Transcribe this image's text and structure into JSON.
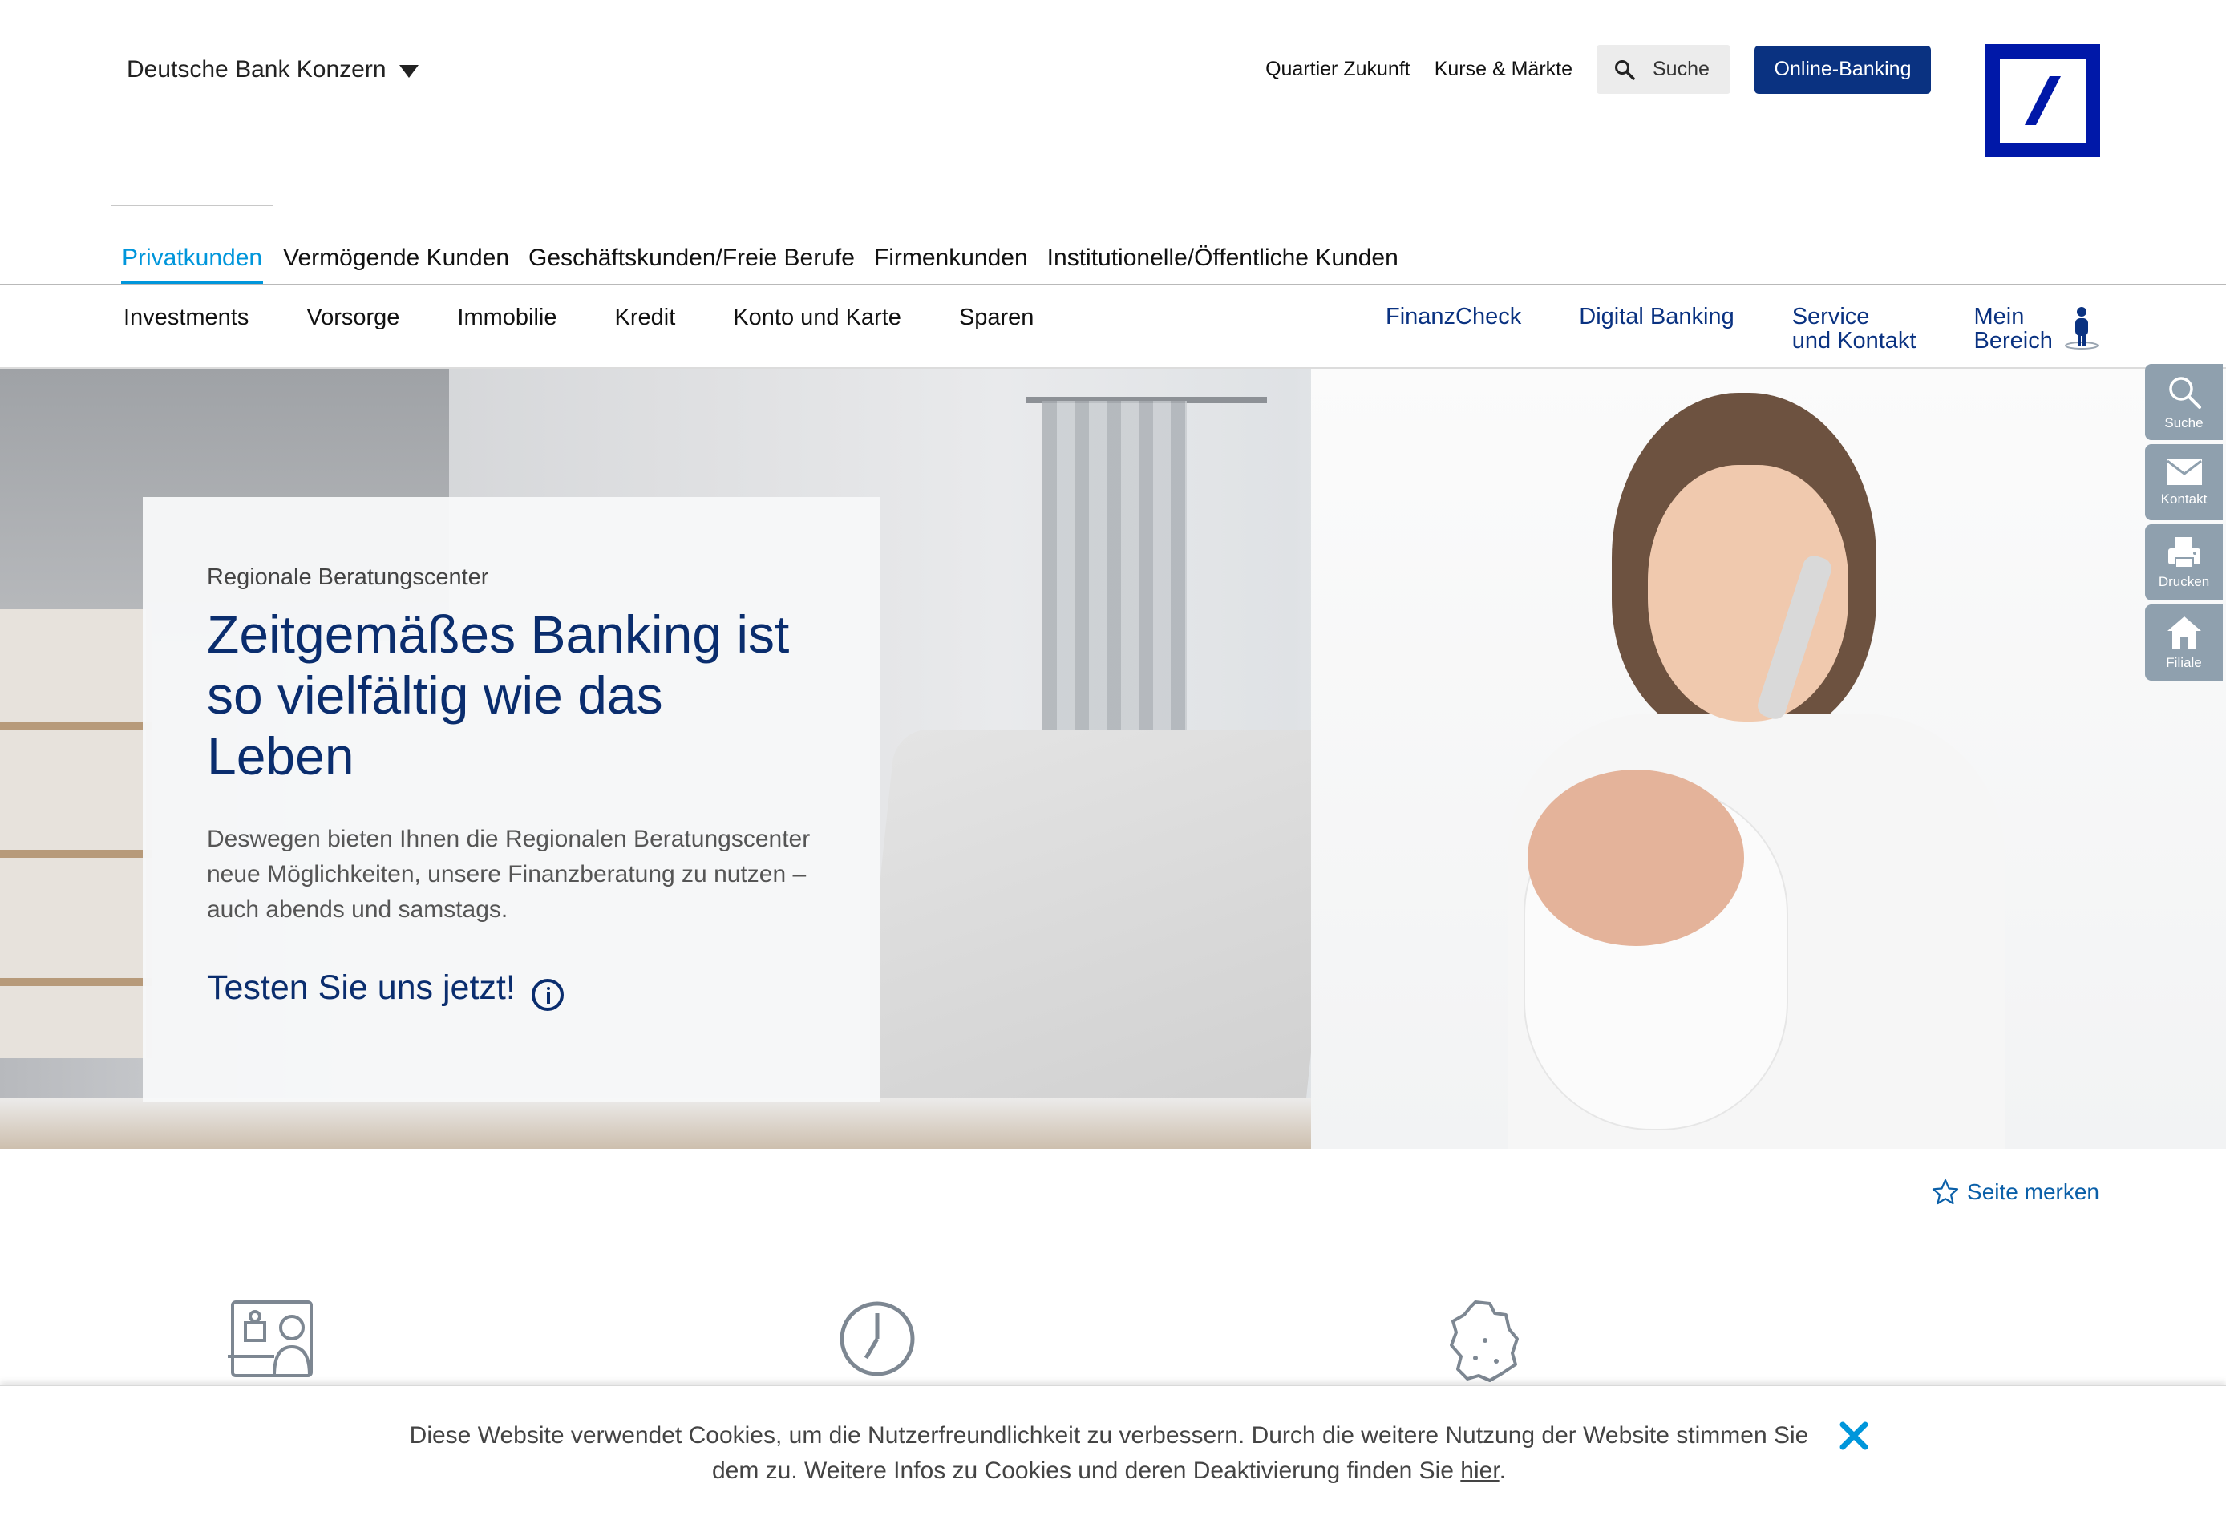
{
  "header": {
    "group_label": "Deutsche Bank Konzern",
    "links": [
      "Quartier Zukunft",
      "Kurse & Märkte"
    ],
    "search_label": "Suche",
    "online_banking_label": "Online-Banking"
  },
  "primary_nav": {
    "items": [
      "Privatkunden",
      "Vermögende Kunden",
      "Geschäftskunden/Freie Berufe",
      "Firmenkunden",
      "Institutionelle/Öffentliche Kunden"
    ],
    "active": "Privatkunden"
  },
  "secondary_nav": {
    "items": [
      "Investments",
      "Vorsorge",
      "Immobilie",
      "Kredit",
      "Konto und Karte",
      "Sparen"
    ],
    "right_items": [
      "FinanzCheck",
      "Digital Banking"
    ],
    "service": [
      "Service",
      "und Kontakt"
    ],
    "mein": [
      "Mein",
      "Bereich"
    ]
  },
  "hero": {
    "kicker": "Regionale Beratungscenter",
    "title_line1": "Zeitgemäßes Banking ist",
    "title_line2": "so vielfältig wie das Leben",
    "text": "Deswegen bieten Ihnen die Regionalen Beratungscenter neue Möglichkeiten, unsere Finanzberatung zu nutzen – auch abends und samstags.",
    "cta": "Testen Sie uns jetzt!"
  },
  "side_tools": [
    {
      "label": "Suche",
      "icon": "search-icon"
    },
    {
      "label": "Kontakt",
      "icon": "envelope-icon"
    },
    {
      "label": "Drucken",
      "icon": "printer-icon"
    },
    {
      "label": "Filiale",
      "icon": "home-icon"
    }
  ],
  "bookmark": {
    "label": "Seite merken",
    "icon": "star-icon"
  },
  "features": [
    {
      "icon": "video-consultation-icon"
    },
    {
      "icon": "clock-icon"
    },
    {
      "icon": "germany-map-icon"
    }
  ],
  "cookie": {
    "text_line1": "Diese Website verwendet Cookies, um die Nutzerfreundlichkeit zu verbessern. Durch die weitere Nutzung der Website stimmen Sie",
    "text_line2": "dem zu. Weitere Infos zu Cookies und deren Deaktivierung finden Sie",
    "link_label": "hier",
    "suffix": "."
  },
  "colors": {
    "brand_blue": "#0018a8",
    "navy": "#0a3281",
    "active_tab": "#0096db",
    "side_tool_bg": "#8fa0ae",
    "cookie_close": "#0096db"
  }
}
